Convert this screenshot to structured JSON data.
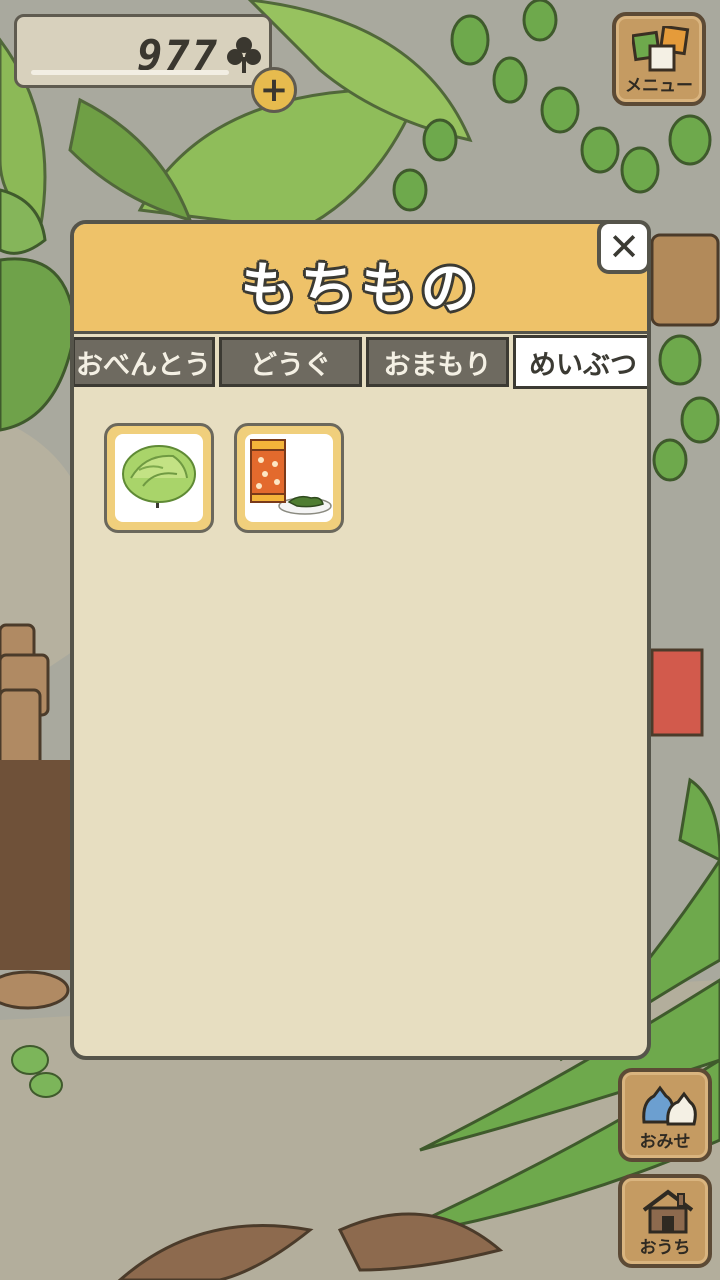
{
  "hud": {
    "clover_count": "977",
    "plus_label": "+",
    "menu_label": "メニュー",
    "shop_label": "おみせ",
    "home_label": "おうち"
  },
  "inventory": {
    "title": "もちもの",
    "close_label": "✕",
    "tabs": [
      {
        "label": "おべんとう",
        "active": false
      },
      {
        "label": "どうぐ",
        "active": false
      },
      {
        "label": "おまもり",
        "active": false
      },
      {
        "label": "めいぶつ",
        "active": true
      }
    ],
    "items": [
      {
        "icon": "cabbage-icon"
      },
      {
        "icon": "tea-canister-icon"
      }
    ]
  },
  "colors": {
    "header": "#eec269",
    "panel": "#e7dec1",
    "tab_inactive": "#6e6a60",
    "tab_active": "#ffffff",
    "slot": "#f0cf7c"
  }
}
